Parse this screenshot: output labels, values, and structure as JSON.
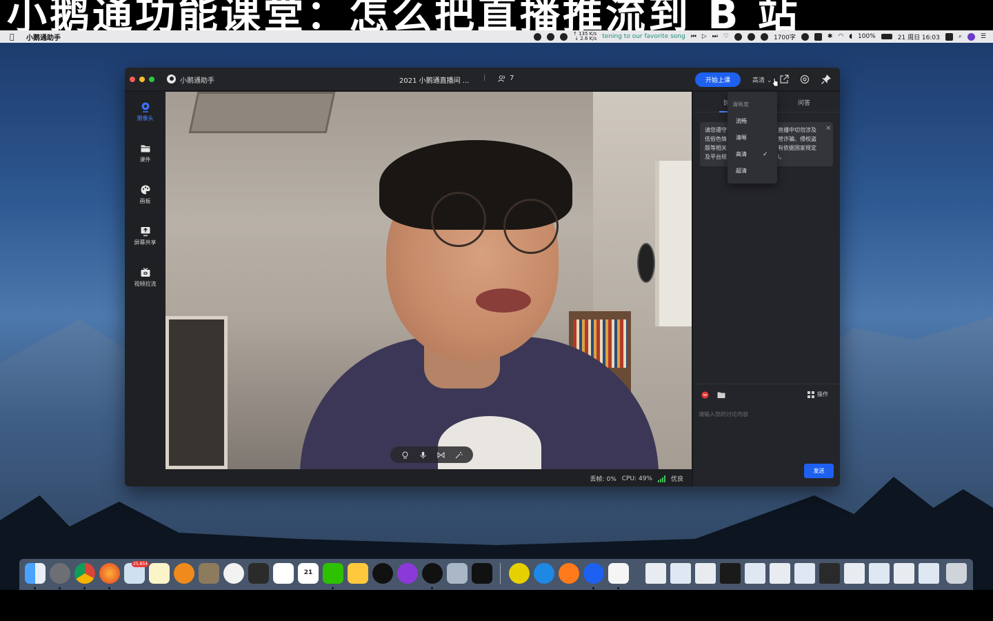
{
  "banner": {
    "text": "小鹅通功能课堂：怎么把直播推流到 B 站"
  },
  "menubar": {
    "app_name": "小鹅通助手",
    "net_up": "↑ 135 K/s",
    "net_down": "↓ 2.6 K/s",
    "lyric": "tening to our favorite song",
    "word_count": "1700字",
    "battery": "100%",
    "clock": "21 周日 16:03"
  },
  "window": {
    "app_title": "小鹅通助手",
    "room_title": "2021 小鹅通直播间 ...",
    "separator": "|",
    "people_count": "7",
    "start_button": "开始上课",
    "quality_current": "高清"
  },
  "sidebar": {
    "items": [
      {
        "label": "摄像头",
        "icon": "camera-icon",
        "active": true
      },
      {
        "label": "课件",
        "icon": "folder-icon",
        "active": false
      },
      {
        "label": "画板",
        "icon": "palette-icon",
        "active": false
      },
      {
        "label": "屏幕共享",
        "icon": "screen-share-icon",
        "active": false
      },
      {
        "label": "视频拉流",
        "icon": "video-pull-icon",
        "active": false
      }
    ]
  },
  "status": {
    "dropped_label": "丢帧:",
    "dropped_value": "0%",
    "cpu_label": "CPU:",
    "cpu_value": "49%",
    "network": "优良"
  },
  "chat": {
    "tab_discuss": "讨",
    "tab_qa": "问答",
    "notice": {
      "line1_left": "请您遵守",
      "line2_left": "低俗色情",
      "line3_left": "版等相关",
      "line4_left": "及平台规",
      "line1_right": "直播中切勿涉及",
      "line2_right": "营诈骗、侵权盗",
      "line3_right": "有依据国家规定",
      "line4_right": "l。"
    },
    "ops_label": "操作",
    "input_placeholder": "请输入您的讨论内容",
    "send_label": "发送"
  },
  "quality_menu": {
    "header": "清晰度",
    "options": [
      "流畅",
      "清晰",
      "高清",
      "超清"
    ],
    "selected": "高清"
  },
  "dock": {
    "badge_mail": "25,854",
    "calendar_day": "21"
  },
  "colors": {
    "accent": "#1e61f0",
    "active_nav": "#4b84ff",
    "panel_bg": "#24252a"
  }
}
